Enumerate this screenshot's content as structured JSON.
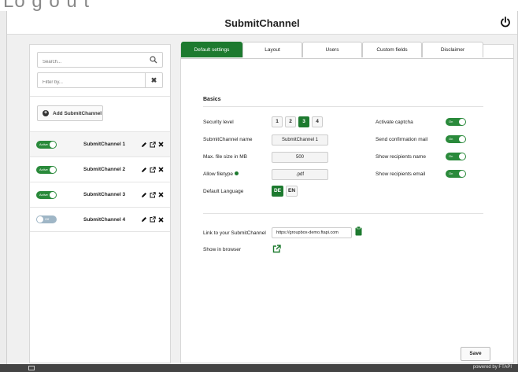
{
  "app": {
    "title": "SubmitChannel"
  },
  "top_strip_text": "Lo g o u t",
  "sidebar": {
    "search_placeholder": "Search...",
    "filter_placeholder": "Filter by...",
    "clear_label": "✖",
    "add_label": "Add SubmitChannel",
    "channels": [
      {
        "name": "SubmitChannel 1",
        "status": "Active",
        "on": true
      },
      {
        "name": "SubmitChannel 2",
        "status": "Active",
        "on": true
      },
      {
        "name": "SubmitChannel 3",
        "status": "Active",
        "on": true
      },
      {
        "name": "SubmitChannel 4",
        "status": "Off",
        "on": false
      }
    ]
  },
  "tabs": [
    {
      "label": "Default settings",
      "active": true
    },
    {
      "label": "Layout",
      "active": false
    },
    {
      "label": "Users",
      "active": false
    },
    {
      "label": "Custom fields",
      "active": false
    },
    {
      "label": "Disclaimer",
      "active": false
    }
  ],
  "basics": {
    "title": "Basics",
    "security_level_label": "Security level",
    "security_levels": [
      "1",
      "2",
      "3",
      "4"
    ],
    "security_selected": "3",
    "name_label": "SubmitChannel name",
    "name_value": "SubmitChannel 1",
    "max_size_label": "Max. file size in MB",
    "max_size_value": "500",
    "filetype_label": "Allow filetype",
    "filetype_value": ".pdf",
    "language_label": "Default Language",
    "languages": [
      "DE",
      "EN"
    ],
    "language_selected": "DE",
    "options": [
      {
        "label": "Activate captcha",
        "value": "On"
      },
      {
        "label": "Send confirmation mail",
        "value": "On"
      },
      {
        "label": "Show recipients name",
        "value": "On"
      },
      {
        "label": "Show recipients email",
        "value": "On"
      }
    ]
  },
  "link": {
    "label": "Link to your SubmitChannel",
    "url": "https://groupbox-demo.ftapi.com",
    "browser_label": "Show in browser"
  },
  "save_label": "Save",
  "footer": {
    "powered": "powered by FTAPI"
  },
  "colors": {
    "accent": "#1d7a2f",
    "toggle_off": "#9fb6c6"
  }
}
